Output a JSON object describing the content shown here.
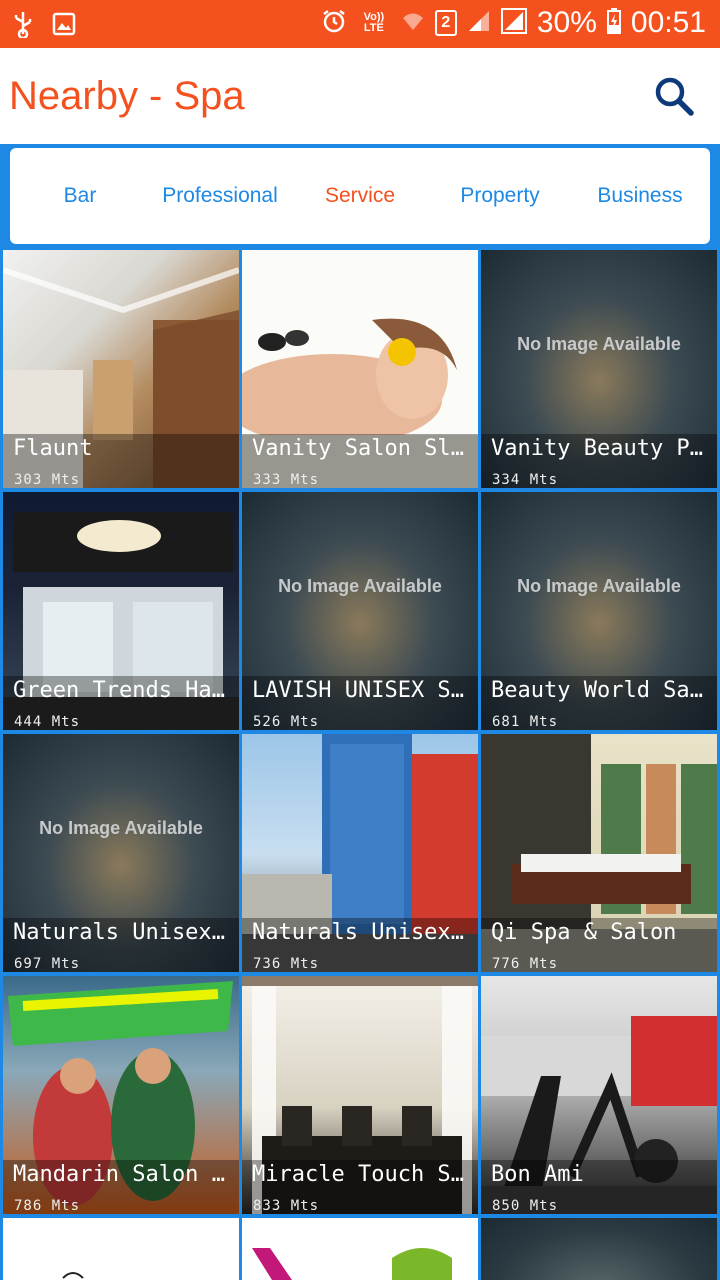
{
  "status_bar": {
    "network_label": "Vo)) LTE",
    "sim": "2",
    "battery": "30%",
    "time": "00:51",
    "icons": [
      "usb-icon",
      "image-icon",
      "alarm-icon",
      "wifi-icon",
      "signal-icon",
      "battery-icon"
    ]
  },
  "app_bar": {
    "title": "Nearby - Spa",
    "search_icon": "search-icon"
  },
  "tabs": [
    {
      "label": "Bar"
    },
    {
      "label": "Professional"
    },
    {
      "label": "Service"
    },
    {
      "label": "Property"
    },
    {
      "label": "Business"
    }
  ],
  "active_tab": "Service",
  "colors": {
    "accent": "#f4511e",
    "primary": "#1e88e5",
    "background": "#1e88e5"
  },
  "no_image_text": "No Image Available",
  "places": [
    {
      "name": "Flaunt",
      "distance": "303 Mts",
      "image": true
    },
    {
      "name": "Vanity Salon Sli…",
      "distance": "333 Mts",
      "image": true
    },
    {
      "name": "Vanity Beauty Pa…",
      "distance": "334 Mts",
      "image": false
    },
    {
      "name": "Green Trends Hai…",
      "distance": "444 Mts",
      "image": true
    },
    {
      "name": "LAVISH UNISEX SP…",
      "distance": "526 Mts",
      "image": false
    },
    {
      "name": "Beauty World Sal…",
      "distance": "681 Mts",
      "image": false
    },
    {
      "name": "Naturals Unisex …",
      "distance": "697 Mts",
      "image": false
    },
    {
      "name": "Naturals Unisex …",
      "distance": "736 Mts",
      "image": true
    },
    {
      "name": "Qi Spa & Salon",
      "distance": "776 Mts",
      "image": true
    },
    {
      "name": "Mandarin Salon &…",
      "distance": "786 Mts",
      "image": true
    },
    {
      "name": "Miracle Touch Sa…",
      "distance": "833 Mts",
      "image": true
    },
    {
      "name": "Bon Ami",
      "distance": "850 Mts",
      "image": true
    }
  ]
}
